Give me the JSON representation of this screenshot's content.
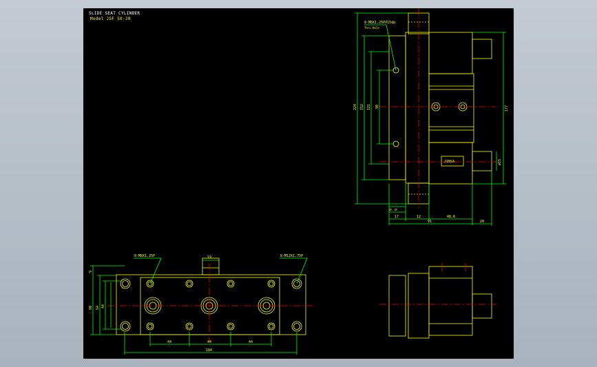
{
  "header": {
    "title": "SLIDE SEAT CYLINDER",
    "model": "Model  JSF 50-20"
  },
  "colors": {
    "background": "#000000",
    "frame": "#b6bdc6",
    "outline": "#ffff00",
    "dimension": "#00ff00",
    "center_line": "#ff0000",
    "white": "#ffffff"
  },
  "front_view": {
    "callout_left": "8-M8X1.25P",
    "callout_right": "8-M12X1.75P",
    "dims": {
      "top_width": "19",
      "total_width": "184",
      "spacing_1": "44",
      "spacing_2": "44",
      "spacing_3": "44",
      "height_outer": "90",
      "height_mid": "54",
      "height_inner": "44",
      "height_small": "9"
    }
  },
  "side_view": {
    "callout_1": "8-M8X1.25PX15dp",
    "callout_2": "Thru Hole",
    "nameplate": "JINSA",
    "dims": {
      "h_total": "224",
      "h_152": "152",
      "h_121": "121",
      "h_90": "90",
      "h_177": "177",
      "rod_dia": "ø15",
      "w_17": "17",
      "w_12": "12",
      "w_48": "48.6",
      "w_91": "91",
      "w_20": "20",
      "small_1": "9",
      "small_2": "9"
    }
  }
}
